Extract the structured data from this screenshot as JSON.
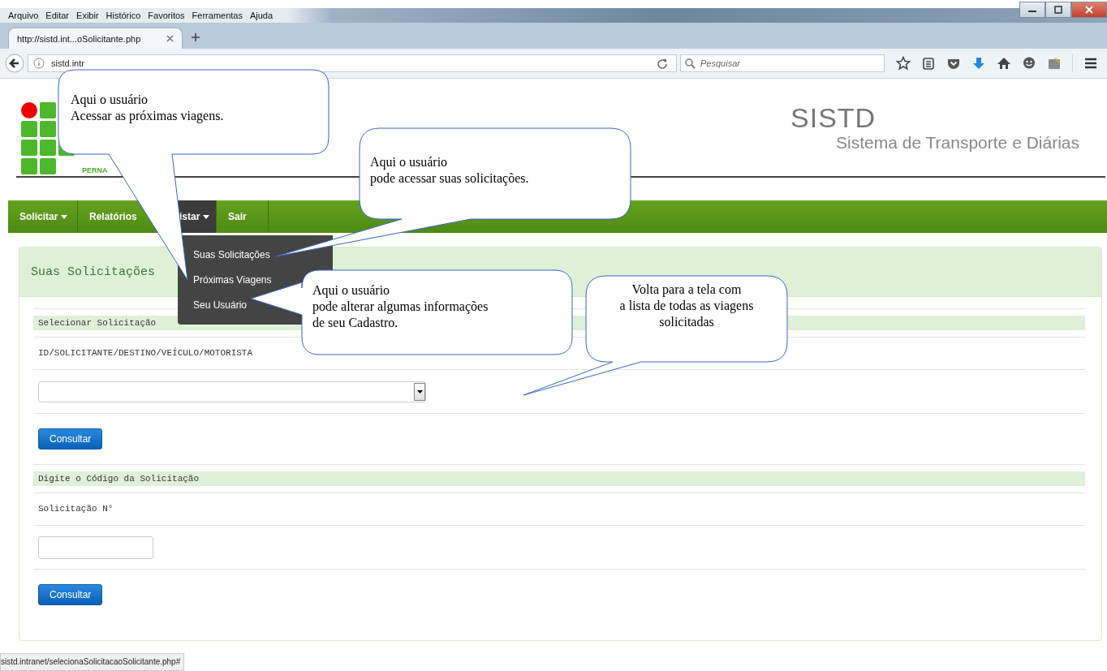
{
  "browser": {
    "menu": [
      "Arquivo",
      "Editar",
      "Exibir",
      "Histórico",
      "Favoritos",
      "Ferramentas",
      "Ajuda"
    ],
    "tabs": [
      {
        "title": "http://sistd.int...oSolicitante.php",
        "selected": true
      }
    ],
    "address": "sistd.intr",
    "search": {
      "placeholder": "Pesquisar"
    },
    "status_bar": "sistd.intranet/selecionaSolicitacaoSolicitante.php#"
  },
  "header": {
    "logo_text": "PERNA",
    "title": "SISTD",
    "subtitle": "Sistema de Transporte e Diárias"
  },
  "nav": [
    {
      "label": "Solicitar",
      "dropdown": true,
      "selected": false
    },
    {
      "label": "Relatórios",
      "dropdown": false,
      "selected": false
    },
    {
      "label": "istar",
      "dropdown": true,
      "selected": true
    },
    {
      "label": "Sair",
      "dropdown": false,
      "selected": false
    }
  ],
  "dropdown_menu": [
    "Suas Solicitações",
    "Próximas Viagens",
    "Seu Usuário"
  ],
  "panel": {
    "title": "Suas Solicitações",
    "sections": [
      {
        "heading": "Selecionar Solicitação",
        "label": "ID/SOLICITANTE/DESTINO/VEÍCULO/MOTORISTA",
        "kind": "select",
        "button": "Consultar"
      },
      {
        "heading": "Digite o Código da Solicitação",
        "label": "Solicitação N°",
        "kind": "text",
        "button": "Consultar"
      }
    ]
  },
  "callouts": [
    {
      "text": "Aqui o usuário\nAcessar as próximas viagens."
    },
    {
      "text": "Aqui o usuário\npode acessar suas solicitações."
    },
    {
      "text": "Aqui o usuário\npode alterar algumas informações\nde seu Cadastro."
    },
    {
      "text": "Volta para a tela com\na lista de todas as viagens\nsolicitadas"
    }
  ]
}
